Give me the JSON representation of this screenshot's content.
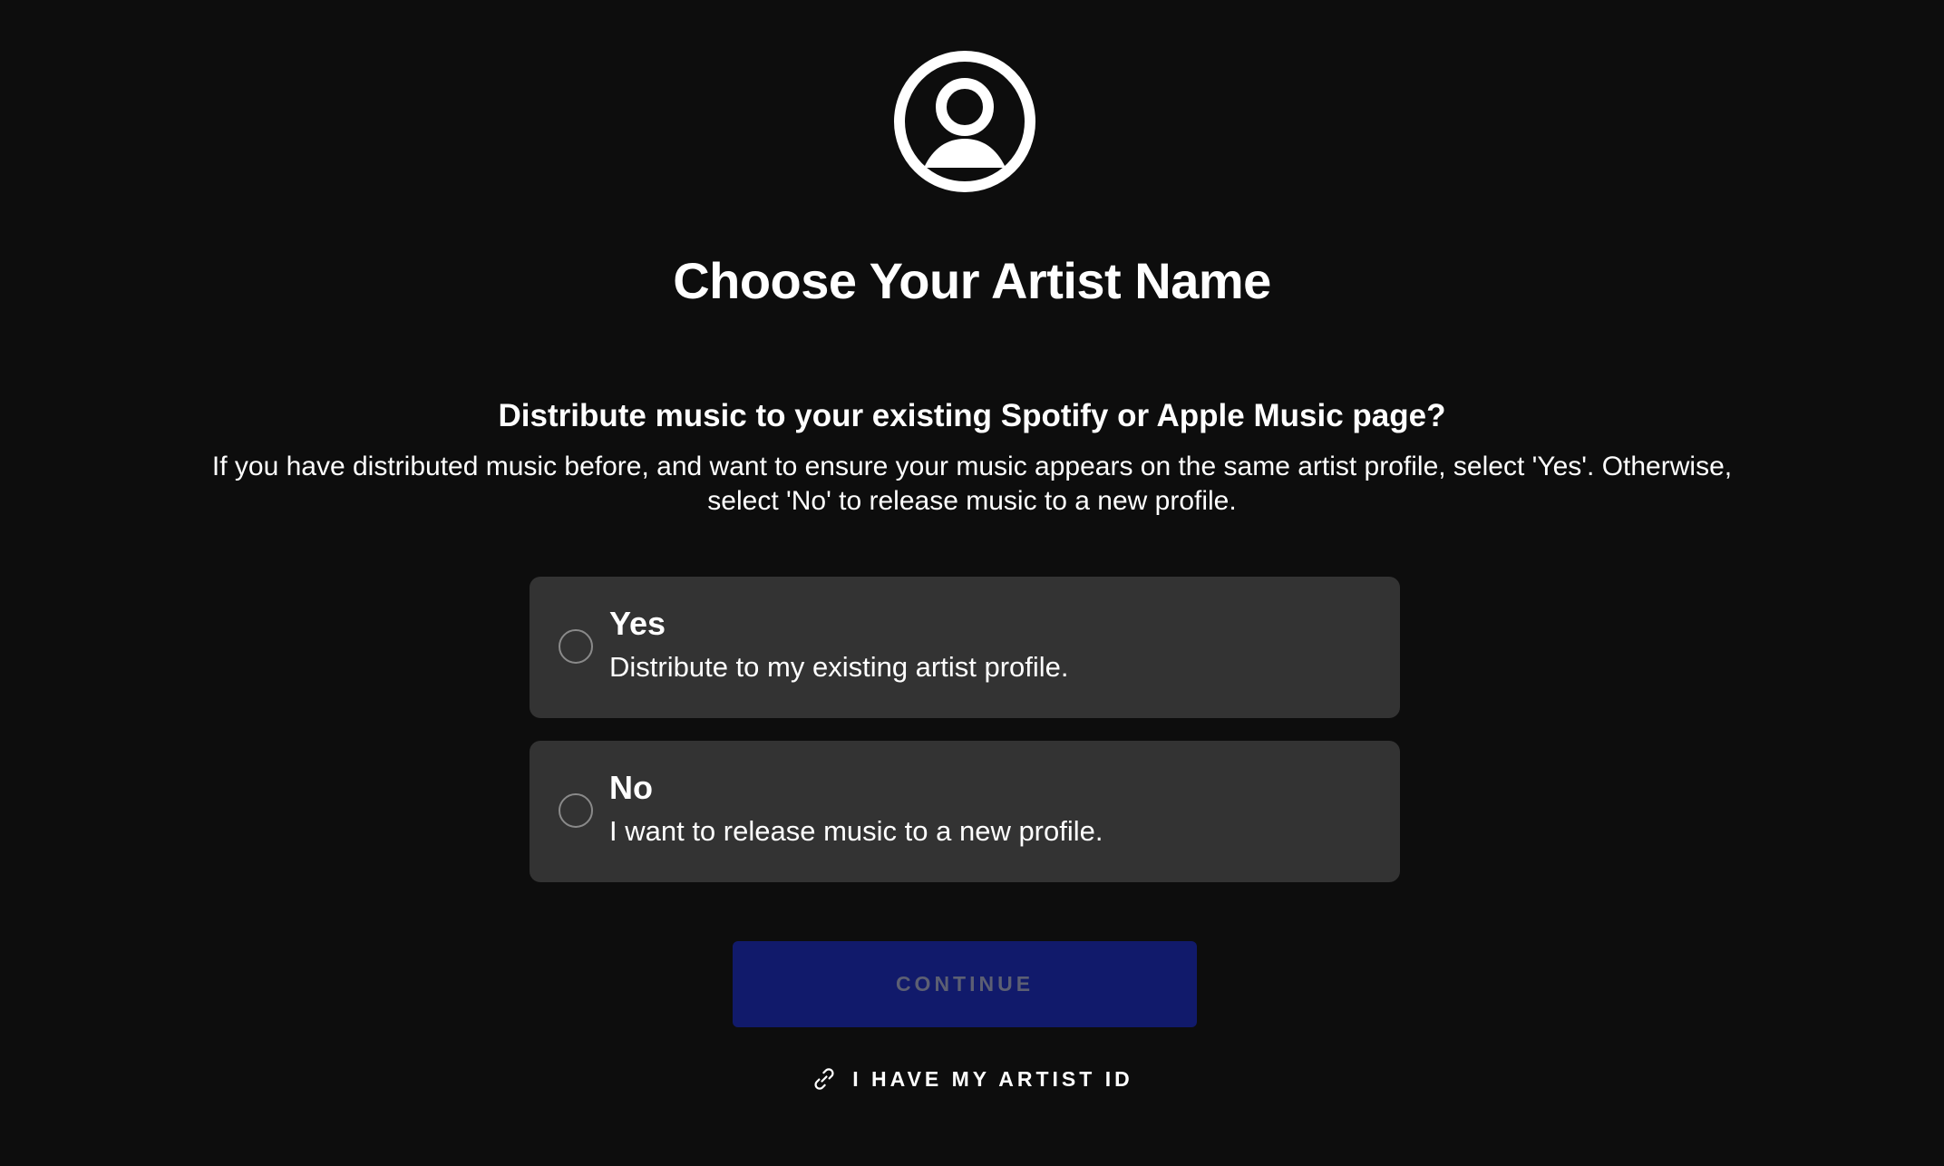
{
  "header": {
    "avatar_icon": "user-circle-icon",
    "title": "Choose Your Artist Name"
  },
  "prompt": {
    "question": "Distribute music to your existing Spotify or Apple Music page?",
    "description": "If you have distributed music before, and want to ensure your music appears on the same artist profile, select 'Yes'. Otherwise, select 'No' to release music to a new profile."
  },
  "options": [
    {
      "label": "Yes",
      "description": "Distribute to my existing artist profile.",
      "selected": false
    },
    {
      "label": "No",
      "description": "I want to release music to a new profile.",
      "selected": false
    }
  ],
  "actions": {
    "continue_label": "CONTINUE",
    "artist_id_label": "I HAVE MY ARTIST ID",
    "artist_id_icon": "link-icon"
  },
  "colors": {
    "background": "#0d0d0d",
    "option_background": "#333333",
    "continue_background": "#111a6b",
    "continue_text": "#5c5f73"
  }
}
